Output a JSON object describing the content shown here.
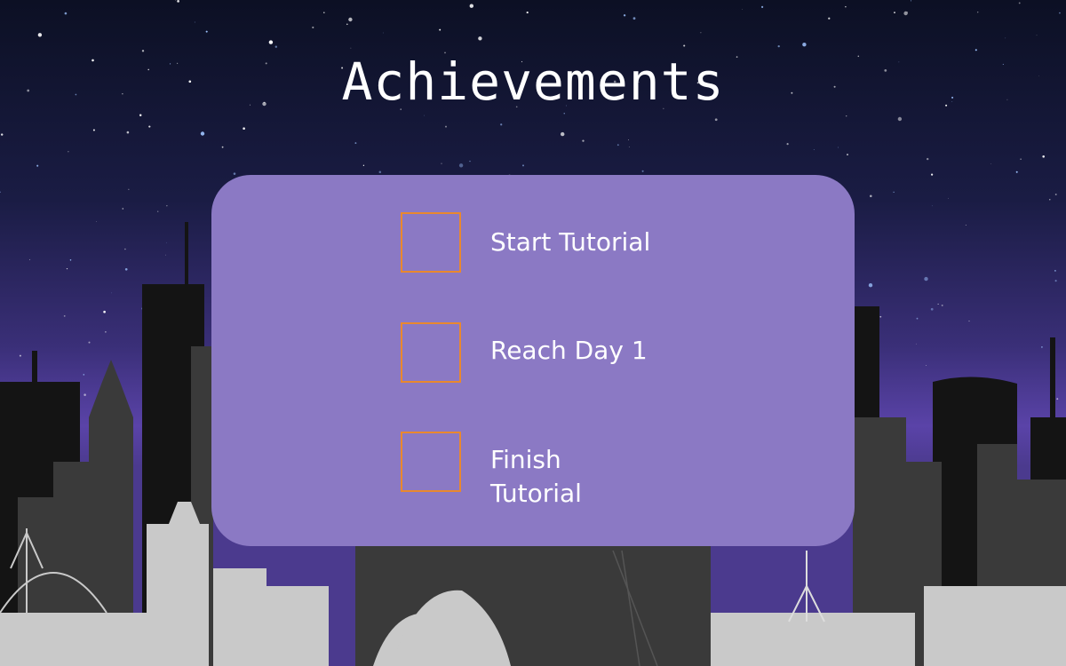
{
  "screen": {
    "title": "Achievements"
  },
  "achievements": [
    {
      "label": "Start Tutorial",
      "completed": false
    },
    {
      "label": "Reach Day 1",
      "completed": false
    },
    {
      "label": "Finish Tutorial",
      "completed": false
    }
  ],
  "colors": {
    "panel": "#8b79c4",
    "checkbox_border": "#e9882e",
    "text": "#ffffff"
  }
}
